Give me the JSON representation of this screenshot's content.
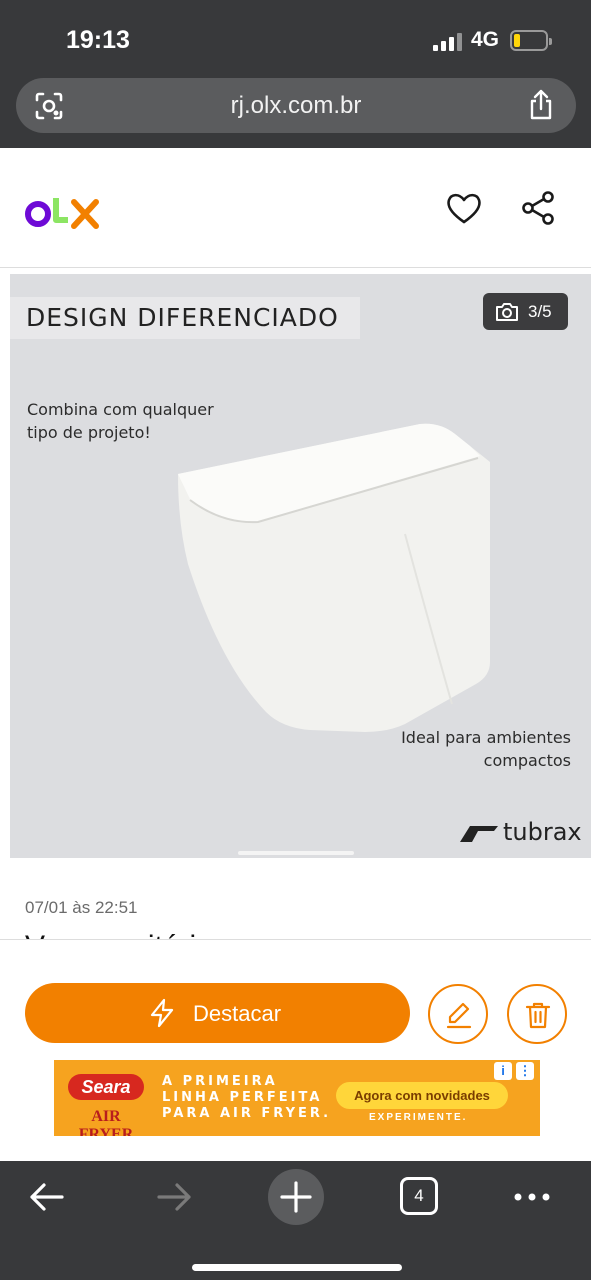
{
  "status_bar": {
    "time": "19:13",
    "network": "4G"
  },
  "browser": {
    "url": "rj.olx.com.br",
    "open_tabs": "4"
  },
  "header": {
    "logo": "OLX"
  },
  "gallery": {
    "banner": "DESIGN DIFERENCIADO",
    "counter": "3/5",
    "caption_left": [
      "Combina com qualquer",
      "tipo de projeto!"
    ],
    "caption_right": [
      "Ideal para ambientes",
      "compactos"
    ],
    "brand": "tubrax"
  },
  "listing": {
    "posted": "07/01 às 22:51",
    "title": "Vaso sanitário"
  },
  "actions": {
    "highlight_label": "Destacar"
  },
  "ad": {
    "brand": "Seara",
    "brand_sub": "AIR FRYER",
    "tagline": [
      "A PRIMEIRA",
      "LINHA PERFEITA",
      "PARA AIR FRYER."
    ],
    "pill": "Agora com novidades",
    "cta": "EXPERIMENTE."
  },
  "colors": {
    "olx_orange": "#f28000",
    "olx_purple": "#6e0ad6",
    "olx_green": "#8ce563",
    "chrome": "#38393b"
  }
}
